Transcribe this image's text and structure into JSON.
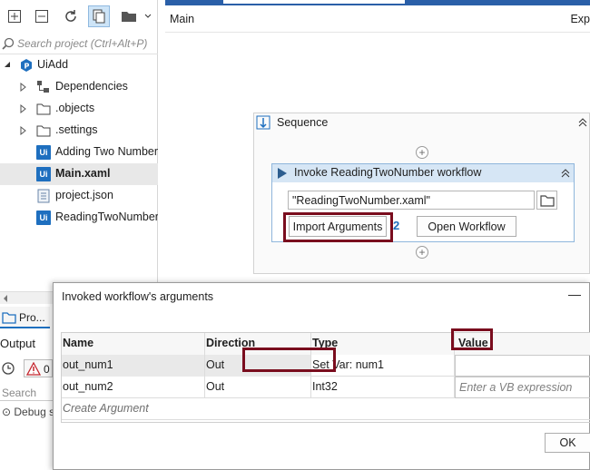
{
  "project_panel": {
    "search_placeholder": "Search project (Ctrl+Alt+P)",
    "tree": [
      {
        "label": "UiAdd",
        "icon": "project-icon"
      },
      {
        "label": "Dependencies",
        "icon": "dependencies-icon"
      },
      {
        "label": ".objects",
        "icon": "folder-icon"
      },
      {
        "label": ".settings",
        "icon": "folder-icon"
      },
      {
        "label": "Adding Two Number.",
        "icon": "workflow-file-icon"
      },
      {
        "label": "Main.xaml",
        "icon": "workflow-file-icon",
        "selected": true
      },
      {
        "label": "project.json",
        "icon": "json-file-icon"
      },
      {
        "label": "ReadingTwoNumber.",
        "icon": "workflow-file-icon"
      }
    ],
    "bottom_tab": "Pro...",
    "output_label": "Output",
    "output_error_count": "0",
    "output_search": "Search",
    "debug_line": "Debug s"
  },
  "designer": {
    "breadcrumb": "Main",
    "expand_link": "Exp",
    "sequence_title": "Sequence",
    "invoke": {
      "title": "Invoke ReadingTwoNumber workflow",
      "workflow_path": "\"ReadingTwoNumber.xaml\"",
      "import_label": "Import Arguments",
      "args_count": "2",
      "open_label": "Open Workflow"
    }
  },
  "dialog": {
    "title": "Invoked workflow's arguments",
    "minimize": "—",
    "columns": [
      "Name",
      "Direction",
      "Type",
      "Value"
    ],
    "rows": [
      {
        "name": "out_num1",
        "direction": "Out",
        "type": "Set Var:  num1",
        "value": ""
      },
      {
        "name": "out_num2",
        "direction": "Out",
        "type": "Int32",
        "value": "Enter a VB expression"
      }
    ],
    "create_argument": "Create Argument",
    "ok_label": "OK"
  },
  "colors": {
    "accent": "#1e6fbf",
    "highlight": "#7a0d1e",
    "activity_header": "#d6e6f5"
  }
}
